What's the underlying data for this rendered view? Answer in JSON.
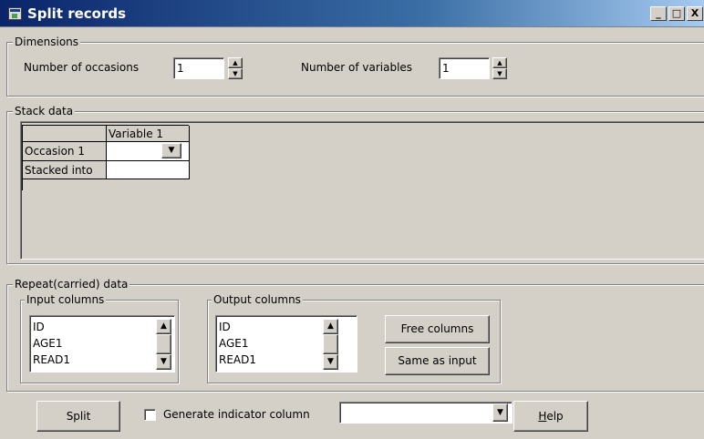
{
  "window": {
    "title": "Split records",
    "controls": {
      "minimize": "_",
      "maximize": "□",
      "close": "X"
    }
  },
  "dimensions": {
    "legend": "Dimensions",
    "occasions_label": "Number of occasions",
    "occasions_value": "1",
    "variables_label": "Number of variables",
    "variables_value": "1"
  },
  "stack": {
    "legend": "Stack data",
    "column_header": "Variable 1",
    "rows": [
      "Occasion 1",
      "Stacked into"
    ]
  },
  "repeat": {
    "legend": "Repeat(carried) data",
    "input": {
      "legend": "Input columns",
      "items": [
        "ID",
        "AGE1",
        "READ1"
      ]
    },
    "output": {
      "legend": "Output columns",
      "items": [
        "ID",
        "AGE1",
        "READ1"
      ]
    },
    "free_columns_label": "Free columns",
    "same_as_input_label": "Same as input"
  },
  "footer": {
    "split_label": "Split",
    "generate_label": "Generate indicator column",
    "generate_checked": false,
    "indicator_value": "",
    "help_accel": "H",
    "help_rest": "elp"
  },
  "icons": {
    "spin_up": "▲",
    "spin_down": "▼",
    "dropdown": "▼",
    "scroll_up": "▲",
    "scroll_down": "▼"
  },
  "colors": {
    "face": "#d4d0c8",
    "title_start": "#0a246a",
    "title_end": "#a6caf0"
  }
}
